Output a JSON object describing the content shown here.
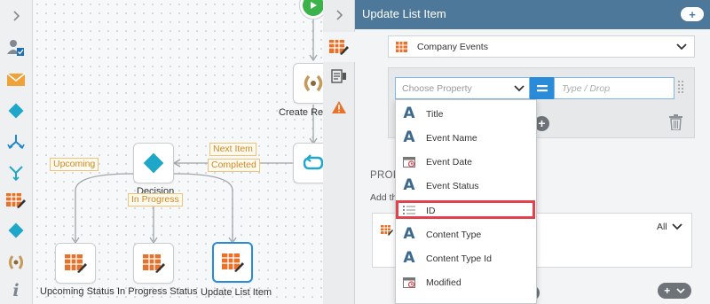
{
  "canvas": {
    "nodes": {
      "create": {
        "label": "Create Refe"
      },
      "decision": {
        "label": "Decision"
      },
      "upcoming": {
        "label": "Upcoming Status"
      },
      "inprogress": {
        "label": "In Progress Status"
      },
      "update": {
        "label": "Update List Item"
      }
    },
    "tags": {
      "next_item": "Next Item",
      "completed": "Completed",
      "upcoming": "Upcoming",
      "in_progress": "In Progress"
    }
  },
  "panel": {
    "title": "Update List Item",
    "add_label": "+",
    "list_name": "Company Events",
    "property_placeholder": "Choose Property",
    "value_placeholder": "Type / Drop",
    "section_title": "PROP",
    "section_hint": "Add th",
    "field_filter": "All",
    "pill_add": "+"
  },
  "dropdown": {
    "options": [
      {
        "label": "Title",
        "icon": "text-icon"
      },
      {
        "label": "Event Name",
        "icon": "text-icon"
      },
      {
        "label": "Event Date",
        "icon": "calendar-icon"
      },
      {
        "label": "Event Status",
        "icon": "text-icon"
      },
      {
        "label": "ID",
        "icon": "list-icon"
      },
      {
        "label": "Content Type",
        "icon": "text-icon"
      },
      {
        "label": "Content Type Id",
        "icon": "text-icon"
      },
      {
        "label": "Modified",
        "icon": "calendar-icon"
      }
    ],
    "highlighted": "ID"
  },
  "colors": {
    "header": "#4e7899",
    "accent": "#2a8bd8",
    "highlight": "#e2424b",
    "orange": "#e8722a",
    "teal": "#1ea7c9"
  }
}
